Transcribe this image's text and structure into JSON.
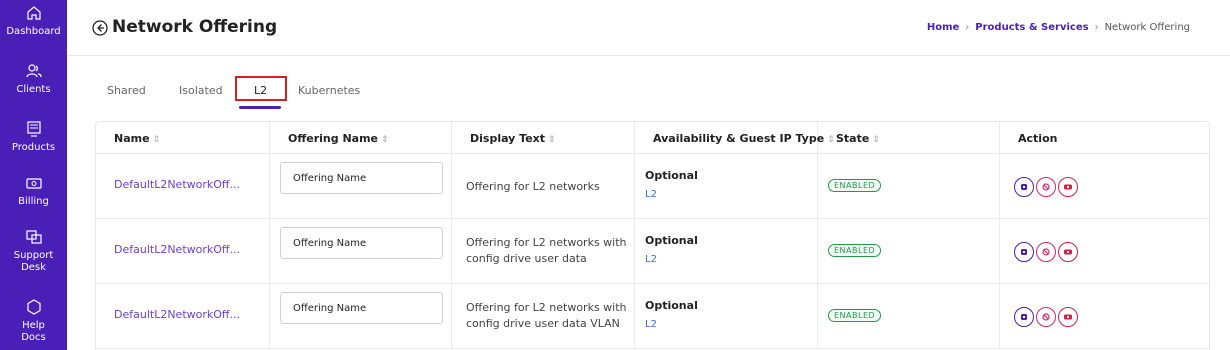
{
  "sidebar": {
    "items": [
      {
        "label": "Dashboard",
        "icon": "home-icon"
      },
      {
        "label": "Clients",
        "icon": "users-icon"
      },
      {
        "label": "Products",
        "icon": "server-icon"
      },
      {
        "label": "Billing",
        "icon": "money-icon"
      },
      {
        "label": "Support Desk",
        "icon": "support-icon"
      },
      {
        "label": "Help Docs",
        "icon": "help-icon"
      }
    ]
  },
  "header": {
    "title": "Network Offering",
    "breadcrumb": {
      "home": "Home",
      "section": "Products & Services",
      "current": "Network Offering"
    }
  },
  "tabs": [
    {
      "label": "Shared",
      "active": false
    },
    {
      "label": "Isolated",
      "active": false
    },
    {
      "label": "L2",
      "active": true
    },
    {
      "label": "Kubernetes",
      "active": false
    }
  ],
  "table": {
    "columns": [
      "Name",
      "Offering Name",
      "Display Text",
      "Availability & Guest IP Type",
      "State",
      "Action"
    ],
    "rows": [
      {
        "name": "DefaultL2NetworkOff...",
        "offering_name": "Offering Name",
        "display_line1": "Offering for L2 networks",
        "display_line2": "",
        "availability": "Optional",
        "guest_ip_type": "L2",
        "state": "ENABLED"
      },
      {
        "name": "DefaultL2NetworkOff...",
        "offering_name": "Offering Name",
        "display_line1": "Offering for L2 networks with",
        "display_line2": "config drive user data",
        "availability": "Optional",
        "guest_ip_type": "L2",
        "state": "ENABLED"
      },
      {
        "name": "DefaultL2NetworkOff...",
        "offering_name": "Offering Name",
        "display_line1": "Offering for L2 networks with",
        "display_line2": "config drive user data VLAN",
        "availability": "Optional",
        "guest_ip_type": "L2",
        "state": "ENABLED"
      }
    ]
  },
  "colors": {
    "sidebar_bg": "#4a1fb8",
    "accent": "#4a1fb8",
    "enabled_green": "#1f9a4a",
    "action_purple": "#4a1fb8",
    "action_pink": "#d6246e",
    "action_red": "#d61f45"
  }
}
